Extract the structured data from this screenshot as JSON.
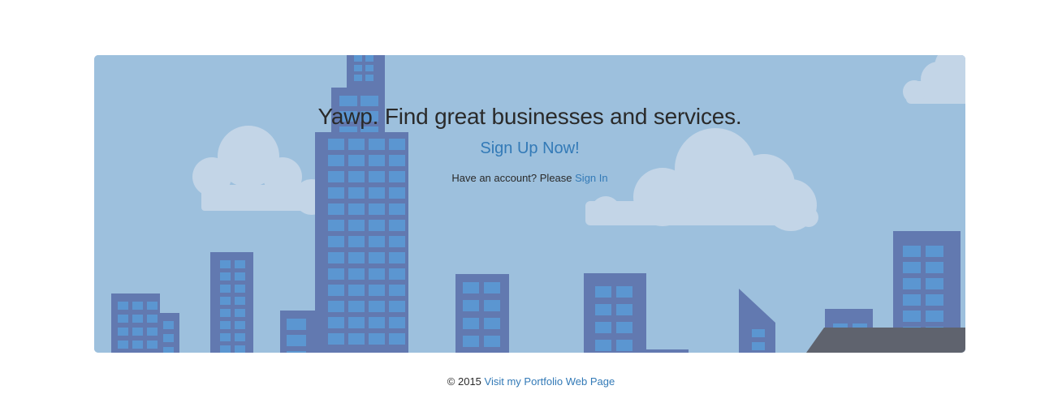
{
  "hero": {
    "headline": "Yawp. Find great businesses and services.",
    "signup_label": "Sign Up Now!",
    "account_prompt": "Have an account? Please",
    "signin_label": "Sign In"
  },
  "footer": {
    "copyright": "© 2015",
    "portfolio_label": "Visit my Portfolio Web Page"
  },
  "colors": {
    "sky": "#9dc0dd",
    "building": "#6279b0",
    "window": "#5b96d1",
    "cloud": "#c3d5e7",
    "roof": "#5f636e",
    "link": "#337ab7",
    "text": "#2a2a2a"
  }
}
